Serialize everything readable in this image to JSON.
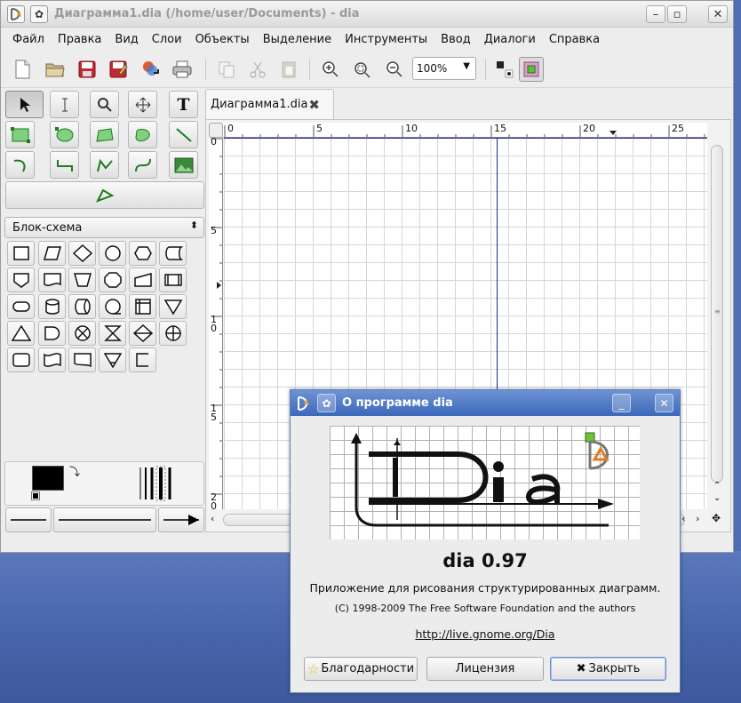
{
  "window": {
    "title": "Диаграмма1.dia (/home/user/Documents) - dia"
  },
  "menu": [
    "Файл",
    "Правка",
    "Вид",
    "Слои",
    "Объекты",
    "Выделение",
    "Инструменты",
    "Ввод",
    "Диалоги",
    "Справка"
  ],
  "toolbar": {
    "zoom_value": "100%"
  },
  "toolbox": {
    "sheet_select": "Блок-схема"
  },
  "tab": {
    "label": "Диаграмма1.dia"
  },
  "rulers": {
    "h_ticks": [
      "0",
      "5",
      "10",
      "15",
      "20",
      "25"
    ],
    "v_ticks": [
      "0",
      "5",
      "1\n0",
      "1\n5",
      "2\n0"
    ]
  },
  "about": {
    "title": "О программе dia",
    "name": "dia 0.97",
    "description": "Приложение для рисования структурированных диаграмм.",
    "copyright": "(C) 1998-2009 The Free Software Foundation and the authors",
    "link": "http://live.gnome.org/Dia",
    "credits_button": "Благодарности",
    "license_button": "Лицензия",
    "close_button": "Закрыть"
  },
  "colors": {
    "titlebar_active": "#3c68bb",
    "desktop": "#4f6db4",
    "canvas_guide": "#1b2a8a"
  }
}
